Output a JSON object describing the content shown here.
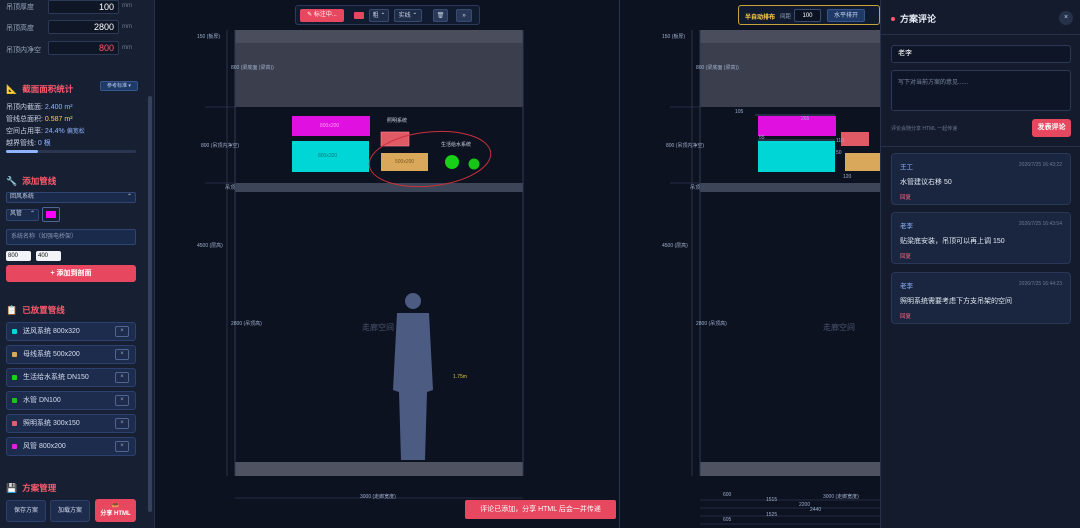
{
  "left_panel": {
    "ceiling_thickness": {
      "label": "吊顶厚度",
      "value": "100",
      "unit": "mm"
    },
    "ceiling_height": {
      "label": "吊顶高度",
      "value": "2800",
      "unit": "mm"
    },
    "ceiling_clearance": {
      "label": "吊顶内净空",
      "value": "800",
      "unit": "mm"
    },
    "section_stats": {
      "title": "截面面积统计",
      "ref_button": "参考标准 ▾",
      "inner_area_label": "吊顶内截面:",
      "inner_area_value": "2.400 m²",
      "pipe_area_label": "管线总面积:",
      "pipe_area_value": "0.587 m²",
      "usage_label": "空间占用率:",
      "usage_value": "24.4%",
      "usage_note": "偏宽松",
      "usage_fraction": 0.244,
      "cross_label": "越界管线:",
      "cross_value": "0 根"
    },
    "add_pipe": {
      "title": "添加管线",
      "system_select": "回风系统",
      "type_select": "风管",
      "color": "#ff00ff",
      "name_placeholder": "系统名称（如强电桥架）",
      "width": "800",
      "height": "400",
      "add_button": "+ 添加到剖面"
    },
    "placed": {
      "title": "已放置管线",
      "items": [
        {
          "label": "送风系统 800x320",
          "color": "#00d8d8",
          "remove": "×"
        },
        {
          "label": "母线系统 500x200",
          "color": "#d9a85a",
          "remove": "×"
        },
        {
          "label": "生活给水系统 DN150",
          "color": "#19d219",
          "remove": "×"
        },
        {
          "label": "水管 DN100",
          "color": "#19c419",
          "remove": "×"
        },
        {
          "label": "照明系统 300x150",
          "color": "#e06070",
          "remove": "×"
        },
        {
          "label": "风管 800x200",
          "color": "#e020e0",
          "remove": "×"
        }
      ]
    },
    "manage": {
      "title": "方案管理",
      "save": "保存方案",
      "load": "加载方案",
      "share": "分享 HTML"
    }
  },
  "canvas": {
    "toolbar_left": {
      "annotate": "✎ 标注中...",
      "stroke": "粗",
      "line": "实线",
      "extra": "»"
    },
    "toolbar_right": {
      "label": "半自动排布",
      "spacing_label": "间距",
      "spacing_value": "100",
      "horizontal": "水平排开"
    },
    "left_view": {
      "dims": {
        "top": "150 (板厚)",
        "beam": "800 (梁底面 (梁高))",
        "ceiling_space": "800 (吊顶内净空)",
        "total": "4500 (层高)",
        "clear": "2800 (吊顶高)",
        "width": "3000 (走廊宽度)",
        "ceiling_mark": "吊顶",
        "person_height": "1.75m",
        "corridor": "走廊空间"
      },
      "pipes": {
        "duct_purple": "800x200",
        "supply": "800x320",
        "busbar": "500x200",
        "lighting_label": "照明系统",
        "water_label": "生活给水系统"
      }
    },
    "right_view": {
      "dims": {
        "top": "150 (板厚)",
        "beam": "800 (梁底面 (梁高))",
        "ceiling_space": "800 (吊顶内净空)",
        "total": "4500 (层高)",
        "clear": "2800 (吊顶高)",
        "width": "3000 (走廊宽度)",
        "ceiling_mark": "吊顶",
        "corridor": "走廊空间",
        "d105": "105",
        "d265": "265",
        "d55": "55",
        "d110": "110",
        "d50": "50",
        "d120": "120",
        "b600": "600",
        "b1515": "1515",
        "b2200": "2200",
        "b2440": "2440",
        "b1525": "1525",
        "b605": "605"
      }
    },
    "toast": "评论已添加，分享 HTML 后会一并传递"
  },
  "comments": {
    "title": "方案评论",
    "close": "×",
    "name_value": "老李",
    "text_placeholder": "写下对当前方案的意见......",
    "hint": "评论会随分享 HTML 一起传递",
    "submit": "发表评论",
    "items": [
      {
        "author": "王工",
        "time": "2026/7/25 16:43:22",
        "content": "水管建议右移 50",
        "reply": "回复"
      },
      {
        "author": "老李",
        "time": "2026/7/25 16:43:54",
        "content": "贴梁底安装，吊顶可以再上调 150",
        "reply": "回复"
      },
      {
        "author": "老李",
        "time": "2026/7/25 16:44:23",
        "content": "照明系统需要考虑下方支吊架的空间",
        "reply": "回复"
      }
    ]
  },
  "colors": {
    "accent": "#e84760",
    "panel": "#172033",
    "canvas": "#0d1220"
  }
}
